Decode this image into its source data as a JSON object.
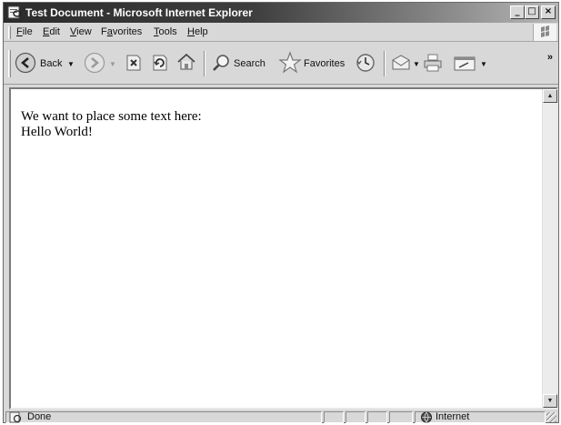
{
  "window": {
    "title": "Test Document - Microsoft Internet Explorer",
    "controls": {
      "minimize": "_",
      "maximize": "□",
      "close": "×"
    }
  },
  "menubar": {
    "items": [
      {
        "label": "File",
        "accel": "F",
        "rest": "ile"
      },
      {
        "label": "Edit",
        "accel": "E",
        "rest": "dit"
      },
      {
        "label": "View",
        "accel": "V",
        "rest": "iew"
      },
      {
        "label": "Favorites",
        "accel_pre": "F",
        "accel": "a",
        "rest": "vorites"
      },
      {
        "label": "Tools",
        "accel": "T",
        "rest": "ools"
      },
      {
        "label": "Help",
        "accel": "H",
        "rest": "elp"
      }
    ]
  },
  "toolbar": {
    "back_label": "Back",
    "search_label": "Search",
    "favorites_label": "Favorites",
    "more_label": "»"
  },
  "page": {
    "lines": [
      "We want to place some text here:",
      "Hello World!"
    ]
  },
  "statusbar": {
    "status": "Done",
    "zone": "Internet"
  },
  "icons": {
    "back": "back-arrow-icon",
    "forward": "forward-arrow-icon",
    "stop": "stop-icon",
    "refresh": "refresh-icon",
    "home": "home-icon",
    "search": "search-icon",
    "favorites": "favorites-star-icon",
    "history": "history-icon",
    "mail": "mail-icon",
    "print": "print-icon",
    "edit": "edit-icon",
    "zone": "internet-globe-icon"
  }
}
